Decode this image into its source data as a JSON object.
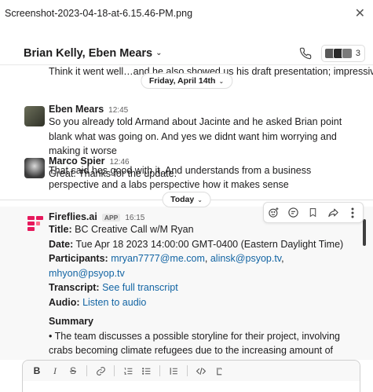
{
  "window": {
    "filename": "Screenshot-2023-04-18-at-6.15.46-PM.png",
    "close_glyph": "✕"
  },
  "header": {
    "channel_name": "Brian Kelly, Eben Mears",
    "member_count": "3"
  },
  "messages": {
    "truncated_line": "Think it went well…and he also showed us his draft presentation; impressive",
    "date_divider_1": "Friday, April 14th",
    "eben": {
      "author": "Eben Mears",
      "time": "12:45",
      "line1": "So you already told Armand about Jacinte and he asked Brian point blank what was going on.  And yes we didnt want him worrying and making it worse",
      "line2": "That said hes good with it.  And understands from a business perspective and a labs perspective how it makes sense"
    },
    "marco": {
      "author": "Marco Spier",
      "time": "12:46",
      "text": "Great. Thanks for the update."
    },
    "date_divider_2": "Today",
    "fireflies": {
      "author": "Fireflies.ai",
      "badge": "APP",
      "time": "16:15",
      "title_label": "Title:",
      "title_value": "BC Creative Call w/M Ryan",
      "date_label": "Date:",
      "date_value": "Tue Apr 18 2023 14:00:00 GMT-0400 (Eastern Daylight Time)",
      "participants_label": "Participants:",
      "participant_1": "mryan7777@me.com",
      "participant_2": "alinsk@psyop.tv",
      "participant_3": "mhyon@psyop.tv",
      "transcript_label": "Transcript:",
      "transcript_link": "See full transcript",
      "audio_label": "Audio:",
      "audio_link": "Listen to audio",
      "summary_heading": "Summary",
      "summary_text": "• The team discusses a possible storyline for their project, involving crabs becoming climate refugees due to the increasing amount of ocean plastics. They consider showing the problem without being preachy and focus on collaboration as a solution. The story includes a journey where the crabs meet"
    }
  },
  "composer": {
    "buttons": [
      "B",
      "I",
      "S",
      "link",
      "ordered-list",
      "bulleted-list",
      "blockquote",
      "code",
      "code-block"
    ]
  },
  "colors": {
    "link": "#1264a3",
    "fireflies_brand": "#e6195c"
  }
}
